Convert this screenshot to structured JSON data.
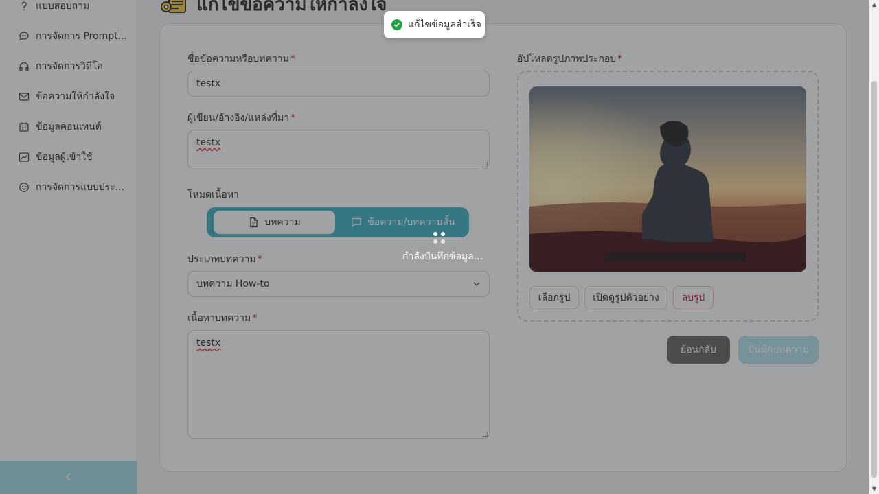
{
  "page": {
    "title": "แก้ไขข้อความให้กำลังใจ"
  },
  "sidebar": {
    "items": [
      {
        "label": "แบบสอบถาม",
        "icon": "question-icon"
      },
      {
        "label": "การจัดการ Prompt...",
        "icon": "chat-icon"
      },
      {
        "label": "การจัดการวิดีโอ",
        "icon": "headphones-icon"
      },
      {
        "label": "ข้อความให้กำลังใจ",
        "icon": "mail-icon"
      },
      {
        "label": "ข้อมูลคอนเทนต์",
        "icon": "calendar-icon"
      },
      {
        "label": "ข้อมูลผู้เข้าใช้",
        "icon": "chart-icon"
      },
      {
        "label": "การจัดการแบบประ...",
        "icon": "smile-icon"
      }
    ],
    "collapse_icon": "chevron-left-icon"
  },
  "form": {
    "title_label": "ชื่อข้อความหรือบทความ",
    "title_value": "testx",
    "author_label": "ผู้เขียน/อ้างอิง/แหล่งที่มา",
    "author_value": "testx",
    "mode_label": "โหมดเนื้อหา",
    "mode_article": "บทความ",
    "mode_short": "ข้อความ/บทความสั้น",
    "type_label": "ประเภทบทความ",
    "type_value": "บทความ How-to",
    "body_label": "เนื้อหาบทความ",
    "body_value": "testx",
    "required_mark": "*"
  },
  "upload": {
    "label": "อัปโหลดรูปภาพประกอบ",
    "choose_button": "เลือกรูป",
    "preview_button": "เปิดดูรูปตัวอย่าง",
    "delete_button": "ลบรูป"
  },
  "actions": {
    "back_button": "ย้อนกลับ",
    "save_button": "บันทึกบทความ"
  },
  "toast": {
    "message": "แก้ไขข้อมูลสำเร็จ",
    "icon": "check-circle-icon",
    "color": "#22a447"
  },
  "loading": {
    "text": "กำลังบันทึกข้อมูล..."
  },
  "colors": {
    "accent": "#47b6c9",
    "danger": "#c0213a",
    "back": "#6b6b6b"
  }
}
